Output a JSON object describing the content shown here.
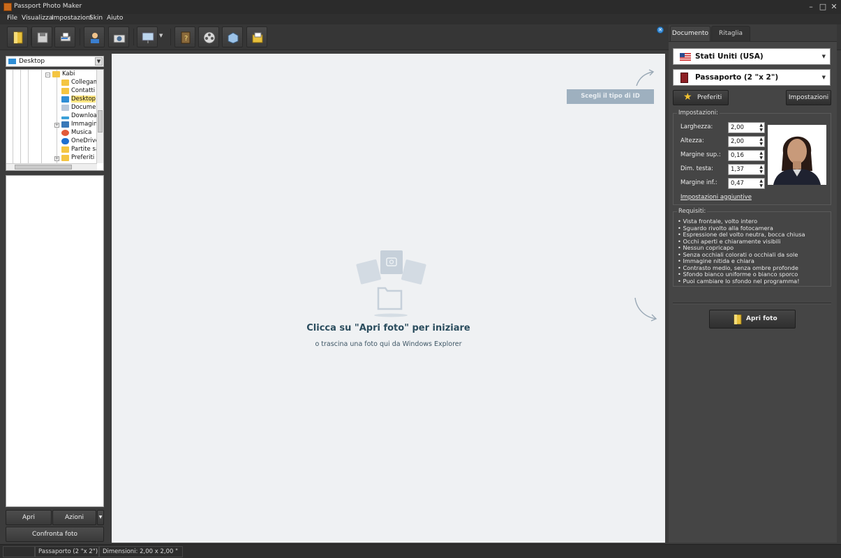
{
  "window": {
    "title": "Passport Photo Maker",
    "controls": {
      "minimize": "–",
      "maximize": "□",
      "close": "✕"
    }
  },
  "menu": [
    "File",
    "Visualizza",
    "Impostazioni",
    "Skin",
    "Aiuto"
  ],
  "toolbar": {
    "icons": [
      "open-icon",
      "save-icon",
      "print-icon",
      "person-icon",
      "camera-icon",
      "presentation-icon",
      "help-book-icon",
      "film-icon",
      "box-icon",
      "folder-chart-icon"
    ]
  },
  "left": {
    "drive": "Desktop",
    "tree": [
      {
        "label": "Kabi",
        "icon": "folder"
      },
      {
        "label": "Collegam",
        "icon": "folder"
      },
      {
        "label": "Contatti",
        "icon": "folder"
      },
      {
        "label": "Desktop",
        "icon": "desktop"
      },
      {
        "label": "Documer",
        "icon": "document"
      },
      {
        "label": "Downloac",
        "icon": "download"
      },
      {
        "label": "Immagin",
        "icon": "image"
      },
      {
        "label": "Musica",
        "icon": "music"
      },
      {
        "label": "OneDrive",
        "icon": "cloud"
      },
      {
        "label": "Partite sa",
        "icon": "folder"
      },
      {
        "label": "Preferiti",
        "icon": "folder"
      }
    ],
    "buttons": {
      "open": "Apri",
      "actions": "Azioni",
      "compare": "Confronta foto"
    }
  },
  "canvas": {
    "id_type_button": "Scegli il tipo di ID",
    "title": "Clicca su \"Apri foto\" per iniziare",
    "subtitle": "o trascina una foto qui da Windows Explorer"
  },
  "right": {
    "tabs": [
      "Documento",
      "Ritaglia"
    ],
    "country": "Stati Uniti (USA)",
    "document": "Passaporto (2 \"x 2\")",
    "favorites": "Preferiti",
    "settings_btn": "Impostazioni",
    "settings_group": "Impostazioni:",
    "fields": [
      {
        "label": "Larghezza:",
        "value": "2,00"
      },
      {
        "label": "Altezza:",
        "value": "2,00"
      },
      {
        "label": "Margine sup.:",
        "value": "0,16"
      },
      {
        "label": "Dim. testa:",
        "value": "1,37"
      },
      {
        "label": "Margine inf.:",
        "value": "0,47"
      }
    ],
    "more_settings": "Impostazioni aggiuntive",
    "requirements_title": "Requisiti:",
    "requirements": [
      "Vista frontale, volto intero",
      "Sguardo rivolto alla fotocamera",
      "Espressione del volto neutra, bocca chiusa",
      "Occhi aperti e chiaramente visibili",
      "Nessun copricapo",
      "Senza occhiali colorati o occhiali da sole",
      "Immagine nitida e chiara",
      "Contrasto medio, senza ombre profonde",
      "Sfondo bianco uniforme o bianco sporco",
      "Puoi cambiare lo sfondo nel programma!"
    ],
    "open_photo": "Apri foto"
  },
  "status": {
    "doc": "Passaporto (2 \"x 2\")",
    "dims": "Dimensioni: 2,00 x 2,00 \""
  }
}
